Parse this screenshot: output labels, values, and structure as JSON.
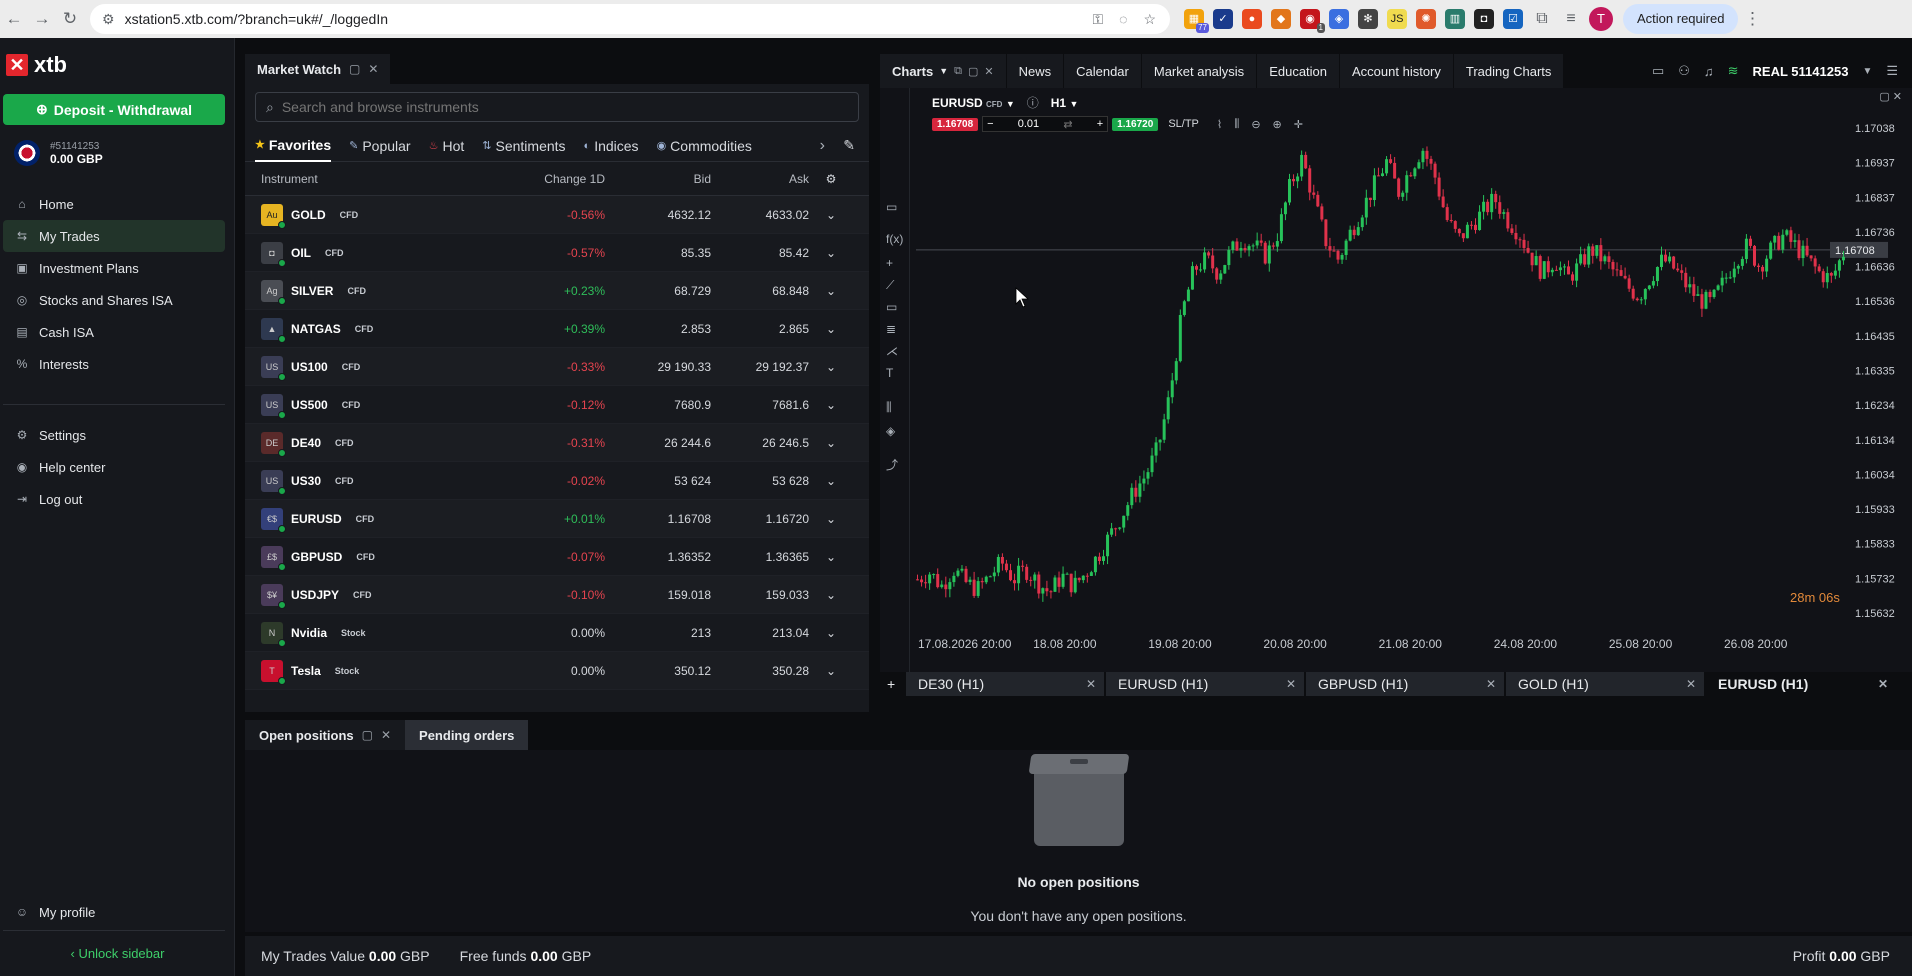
{
  "browser": {
    "url": "xstation5.xtb.com/?branch=uk#/_/loggedIn",
    "action_label": "Action required",
    "avatar_letter": "T",
    "ext_badge_1": "77",
    "ext_badge_2": "1"
  },
  "sidebar": {
    "brand": "xtb",
    "deposit_label": "Deposit - Withdrawal",
    "account_number": "#51141253",
    "account_balance": "0.00 GBP",
    "items": [
      {
        "label": "Home",
        "icon": "home-icon",
        "glyph": "⌂"
      },
      {
        "label": "My Trades",
        "icon": "trades-icon",
        "glyph": "⇆",
        "active": true
      },
      {
        "label": "Investment Plans",
        "icon": "plans-icon",
        "glyph": "▣"
      },
      {
        "label": "Stocks and Shares ISA",
        "icon": "isa-icon",
        "glyph": "◎"
      },
      {
        "label": "Cash ISA",
        "icon": "cash-icon",
        "glyph": "▤"
      },
      {
        "label": "Interests",
        "icon": "percent-icon",
        "glyph": "%"
      }
    ],
    "items2": [
      {
        "label": "Settings",
        "icon": "gear-icon",
        "glyph": "⚙"
      },
      {
        "label": "Help center",
        "icon": "help-icon",
        "glyph": "◉"
      },
      {
        "label": "Log out",
        "icon": "logout-icon",
        "glyph": "⇥"
      }
    ],
    "profile_label": "My profile",
    "unlock_label": "Unlock sidebar"
  },
  "market_watch": {
    "title": "Market Watch",
    "search_placeholder": "Search and browse instruments",
    "categories": [
      "Favorites",
      "Popular",
      "Hot",
      "Sentiments",
      "Indices",
      "Commodities"
    ],
    "columns": {
      "instrument": "Instrument",
      "change": "Change 1D",
      "bid": "Bid",
      "ask": "Ask"
    },
    "rows": [
      {
        "symbol": "GOLD",
        "type": "CFD",
        "change": "-0.56%",
        "bid": "4632.12",
        "ask": "4633.02",
        "dir": "neg",
        "icon_text": "Au",
        "icon_color": "#e6b422"
      },
      {
        "symbol": "OIL",
        "type": "CFD",
        "change": "-0.57%",
        "bid": "85.35",
        "ask": "85.42",
        "dir": "neg",
        "icon_text": "◘",
        "icon_color": "#3b3e45"
      },
      {
        "symbol": "SILVER",
        "type": "CFD",
        "change": "+0.23%",
        "bid": "68.729",
        "ask": "68.848",
        "dir": "pos",
        "icon_text": "Ag",
        "icon_color": "#4a4d54"
      },
      {
        "symbol": "NATGAS",
        "type": "CFD",
        "change": "+0.39%",
        "bid": "2.853",
        "ask": "2.865",
        "dir": "pos",
        "icon_text": "▲",
        "icon_color": "#2e3950"
      },
      {
        "symbol": "US100",
        "type": "CFD",
        "change": "-0.33%",
        "bid": "29 190.33",
        "ask": "29 192.37",
        "dir": "neg",
        "icon_text": "US",
        "icon_color": "#3a3d55"
      },
      {
        "symbol": "US500",
        "type": "CFD",
        "change": "-0.12%",
        "bid": "7680.9",
        "ask": "7681.6",
        "dir": "neg",
        "icon_text": "US",
        "icon_color": "#3a3d55"
      },
      {
        "symbol": "DE40",
        "type": "CFD",
        "change": "-0.31%",
        "bid": "26 244.6",
        "ask": "26 246.5",
        "dir": "neg",
        "icon_text": "DE",
        "icon_color": "#5a2a2a"
      },
      {
        "symbol": "US30",
        "type": "CFD",
        "change": "-0.02%",
        "bid": "53 624",
        "ask": "53 628",
        "dir": "neg",
        "icon_text": "US",
        "icon_color": "#3a3d55"
      },
      {
        "symbol": "EURUSD",
        "type": "CFD",
        "change": "+0.01%",
        "bid": "1.16708",
        "ask": "1.16720",
        "dir": "pos",
        "icon_text": "€$",
        "icon_color": "#33407a"
      },
      {
        "symbol": "GBPUSD",
        "type": "CFD",
        "change": "-0.07%",
        "bid": "1.36352",
        "ask": "1.36365",
        "dir": "neg",
        "icon_text": "£$",
        "icon_color": "#4a3b5a"
      },
      {
        "symbol": "USDJPY",
        "type": "CFD",
        "change": "-0.10%",
        "bid": "159.018",
        "ask": "159.033",
        "dir": "neg",
        "icon_text": "$¥",
        "icon_color": "#4a3b5a"
      },
      {
        "symbol": "Nvidia",
        "type": "Stock",
        "change": "0.00%",
        "bid": "213",
        "ask": "213.04",
        "dir": "neu",
        "icon_text": "N",
        "icon_color": "#2d3a2a"
      },
      {
        "symbol": "Tesla",
        "type": "Stock",
        "change": "0.00%",
        "bid": "350.12",
        "ask": "350.28",
        "dir": "neu",
        "icon_text": "T",
        "icon_color": "#c8102e"
      }
    ]
  },
  "charts": {
    "title": "Charts",
    "nav": [
      "News",
      "Calendar",
      "Market analysis",
      "Education",
      "Account history",
      "Trading Charts"
    ],
    "account": "REAL  51141253",
    "symbol": "EURUSD",
    "symbol_type": "CFD",
    "interval": "H1",
    "sell_price": "1.16708",
    "buy_price": "1.16720",
    "volume": "0.01",
    "sltp": "SL/TP",
    "timer": "28m 06s",
    "current_price": "1.16708",
    "sell_color": "#d7263d",
    "buy_color": "#1aa84a",
    "tabs": [
      "DE30 (H1)",
      "EURUSD (H1)",
      "GBPUSD (H1)",
      "GOLD (H1)",
      "EURUSD (H1)"
    ]
  },
  "chart_data": {
    "type": "candlestick",
    "x_ticks": [
      "17.08.2026 20:00",
      "18.08 20:00",
      "19.08 20:00",
      "20.08 20:00",
      "21.08 20:00",
      "24.08 20:00",
      "25.08 20:00",
      "26.08 20:00"
    ],
    "y_ticks": [
      "1.17038",
      "1.16937",
      "1.16837",
      "1.16736",
      "1.16636",
      "1.16536",
      "1.16435",
      "1.16335",
      "1.16234",
      "1.16134",
      "1.16034",
      "1.15933",
      "1.15833",
      "1.15732",
      "1.15632"
    ],
    "ylim": [
      1.1563,
      1.1707
    ],
    "current_price": 1.16708,
    "close_path": [
      1.1573,
      1.1575,
      1.1571,
      1.1576,
      1.1572,
      1.157,
      1.1574,
      1.1578,
      1.1573,
      1.1576,
      1.1572,
      1.1569,
      1.1574,
      1.1571,
      1.1575,
      1.158,
      1.1586,
      1.1592,
      1.1599,
      1.1604,
      1.1612,
      1.1628,
      1.1652,
      1.1665,
      1.1668,
      1.1664,
      1.167,
      1.1674,
      1.1672,
      1.1669,
      1.1676,
      1.169,
      1.1698,
      1.1685,
      1.1673,
      1.1668,
      1.1676,
      1.1683,
      1.169,
      1.1697,
      1.1688,
      1.1695,
      1.1701,
      1.1693,
      1.168,
      1.1674,
      1.1678,
      1.1682,
      1.1686,
      1.168,
      1.1676,
      1.1669,
      1.1664,
      1.1668,
      1.1662,
      1.1666,
      1.1671,
      1.1668,
      1.1664,
      1.166,
      1.1657,
      1.1663,
      1.1668,
      1.1665,
      1.166,
      1.1656,
      1.1655,
      1.1661,
      1.1668,
      1.1672,
      1.1666,
      1.1671,
      1.1675,
      1.1672,
      1.1668,
      1.1664,
      1.1662,
      1.167
    ]
  },
  "positions": {
    "tab_open": "Open positions",
    "tab_pending": "Pending orders",
    "empty_title": "No open positions",
    "empty_text": "You don't have any open positions."
  },
  "footer": {
    "trades_label": "My Trades Value",
    "trades_value": "0.00",
    "currency": "GBP",
    "free_label": "Free funds",
    "free_value": "0.00",
    "profit_label": "Profit",
    "profit_value": "0.00"
  }
}
